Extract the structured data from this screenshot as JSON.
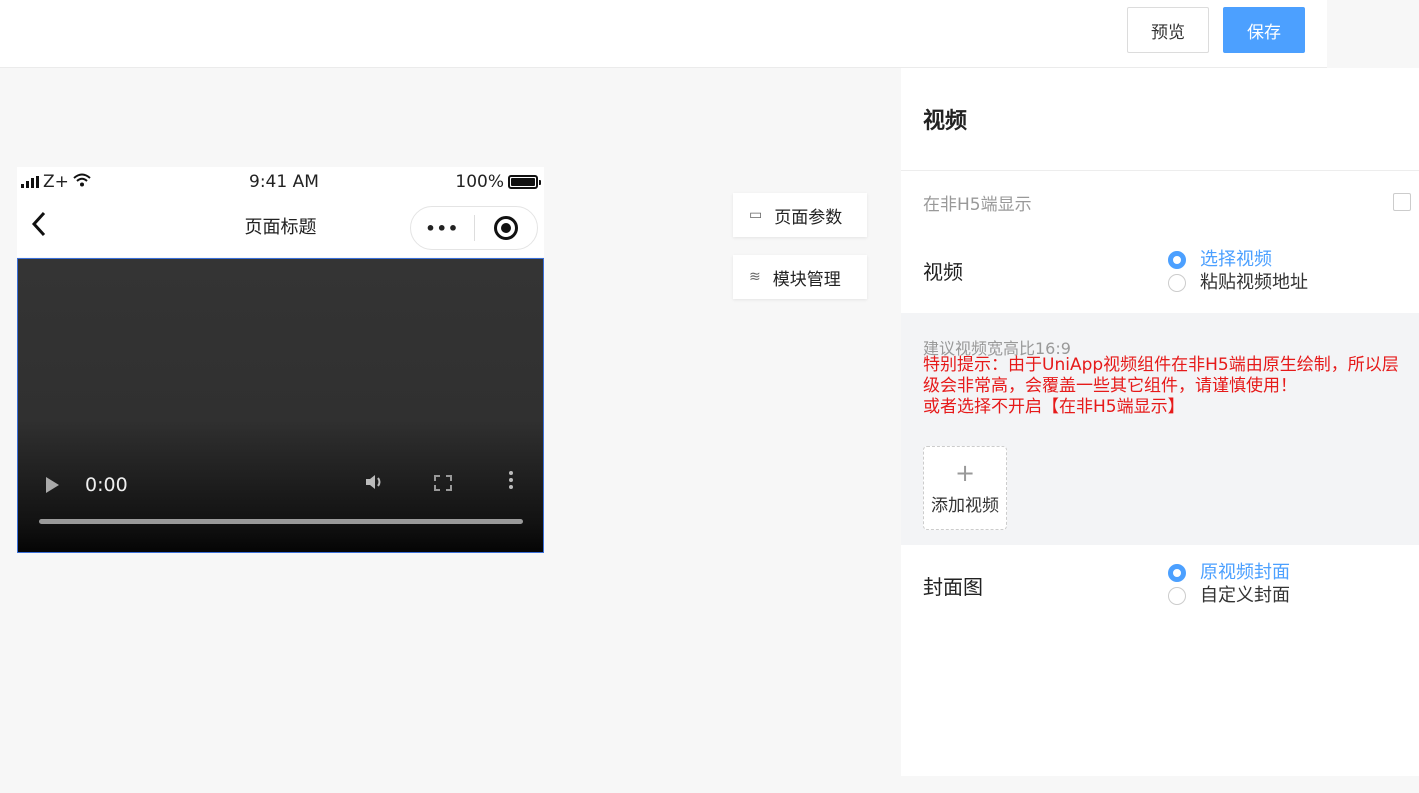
{
  "toolbar": {
    "preview_label": "预览",
    "save_label": "保存",
    "accent_color": "#4ca0ff"
  },
  "phone": {
    "status": {
      "carrier": "Z+",
      "time": "9:41 AM",
      "battery": "100%"
    },
    "nav_title": "页面标题",
    "capsule_dots": "•••",
    "video": {
      "time": "0:00",
      "volume_icon": "speaker-icon",
      "fullscreen_icon": "fullscreen-icon",
      "more_icon": "more-vertical-icon"
    }
  },
  "side_buttons": [
    {
      "label": "页面参数",
      "icon": "▭"
    },
    {
      "label": "模块管理",
      "icon": "≋"
    }
  ],
  "panel": {
    "title": "视频",
    "non_h5_label": "在非H5端显示",
    "video_field": {
      "label": "视频",
      "options": [
        "选择视频",
        "粘贴视频地址"
      ],
      "selected": "选择视频"
    },
    "hint": "建议视频宽高比16:9",
    "warning_1": "特别提示：由于UniApp视频组件在非H5端由原生绘制，所以层级会非常高，会覆盖一些其它组件，请谨慎使用！",
    "warning_2": "或者选择不开启【在非H5端显示】",
    "add_video": {
      "plus": "+",
      "label": "添加视频"
    },
    "cover_field": {
      "label": "封面图",
      "options": [
        "原视频封面",
        "自定义封面"
      ],
      "selected": "原视频封面"
    }
  }
}
